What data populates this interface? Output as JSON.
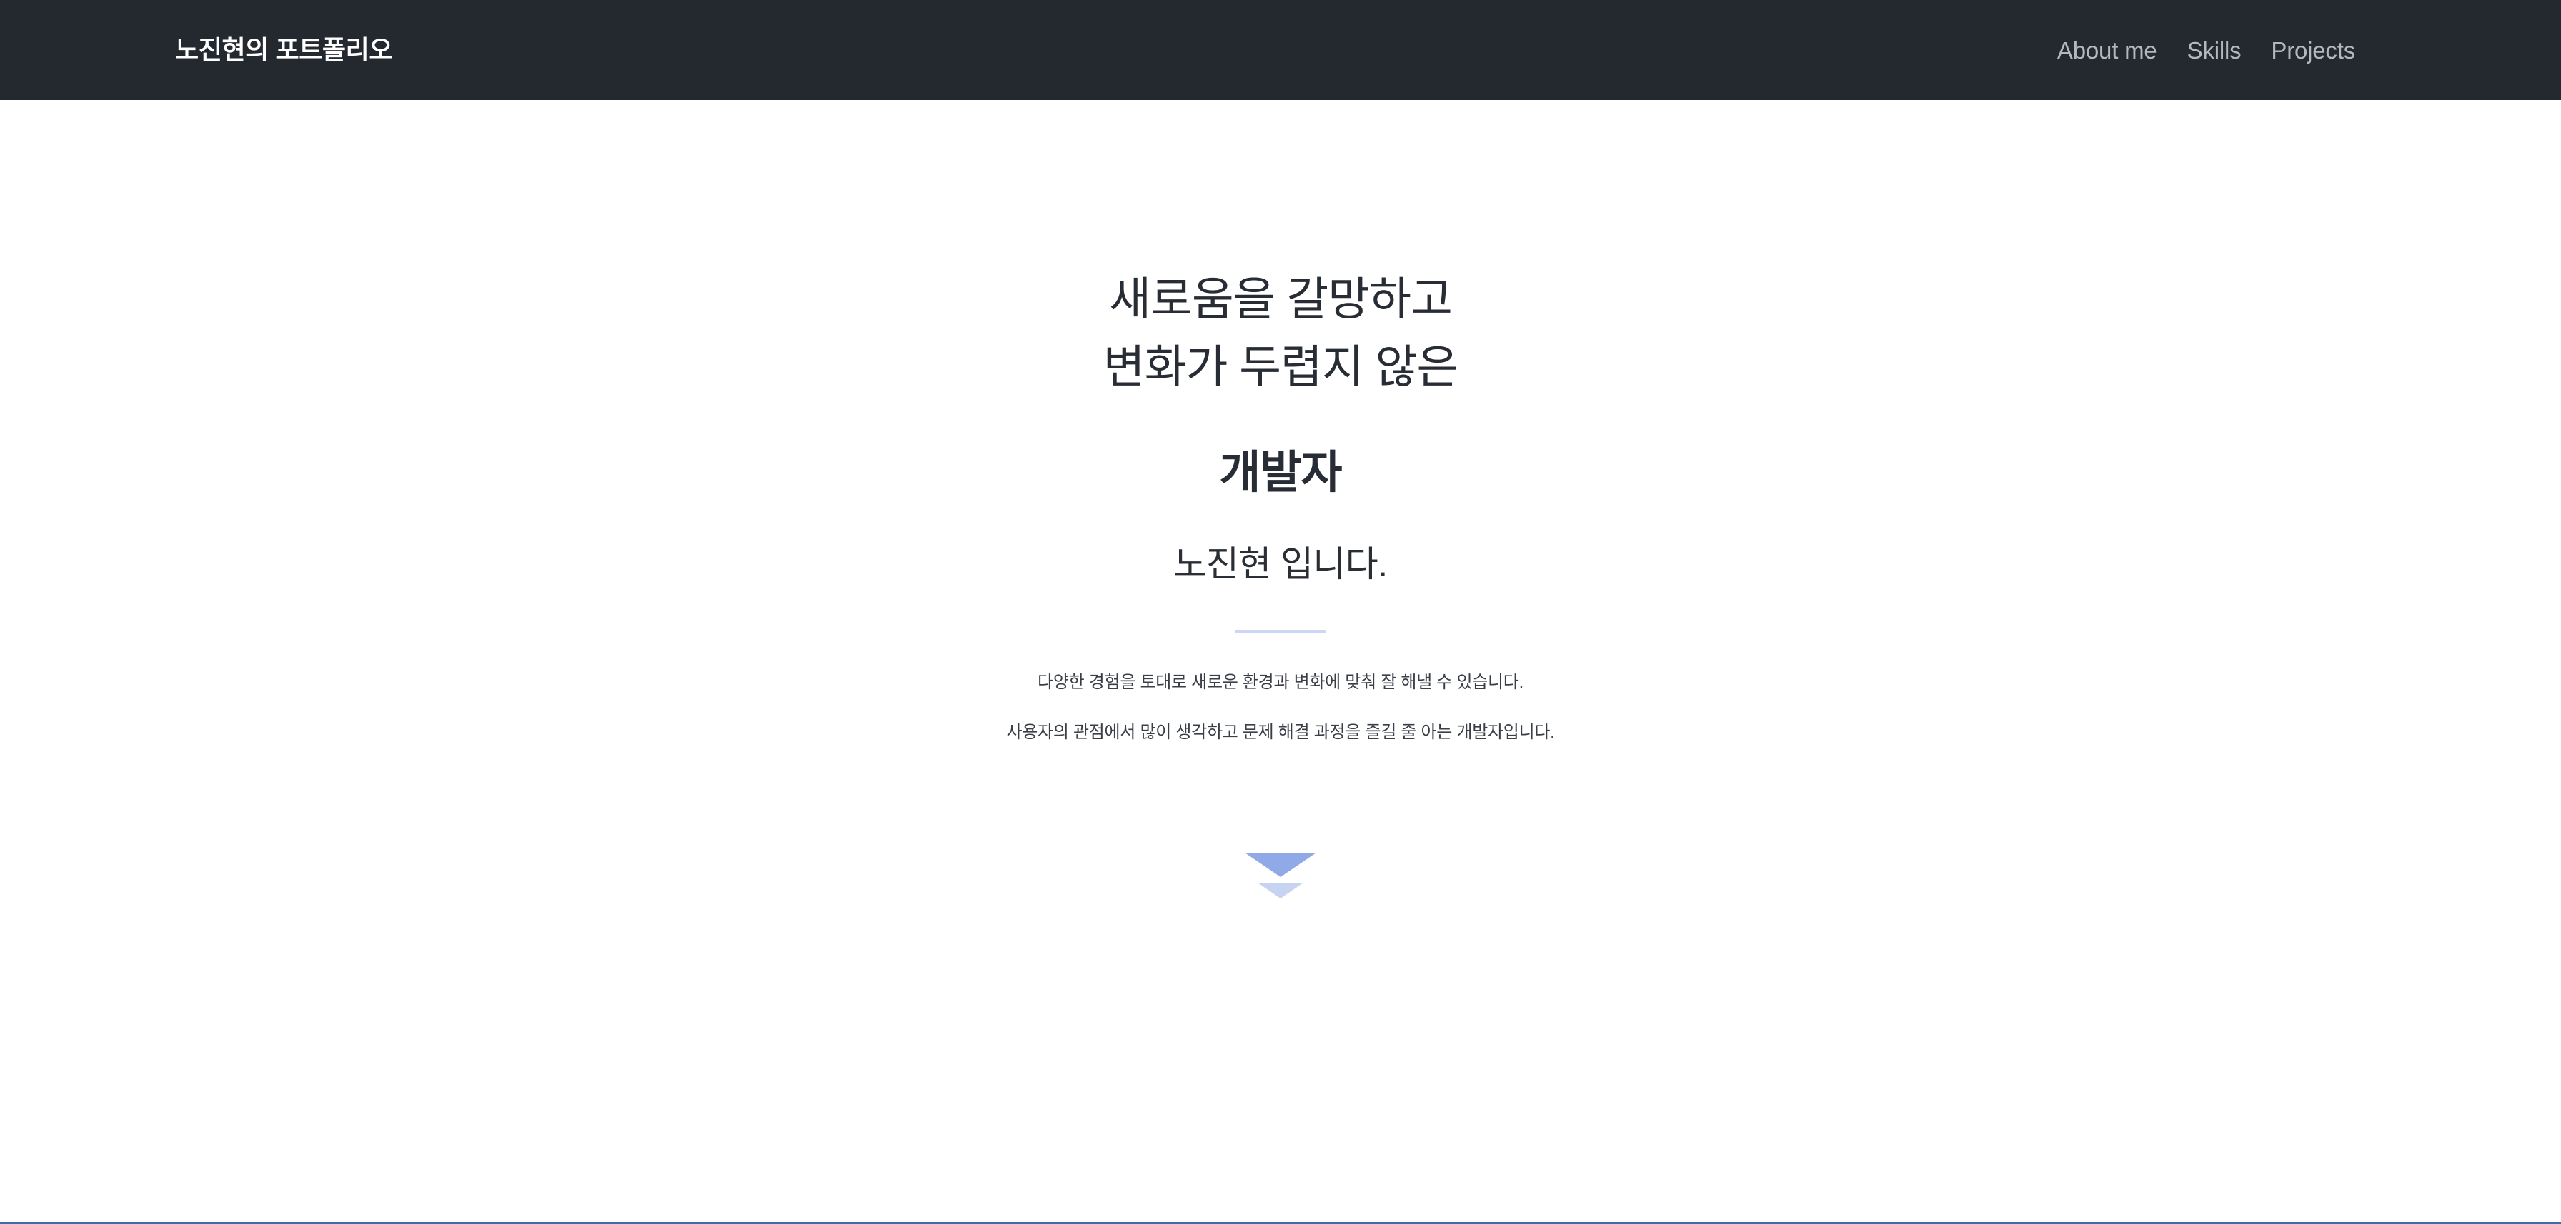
{
  "navbar": {
    "brand": "노진현의 포트폴리오",
    "links": [
      {
        "label": "About me"
      },
      {
        "label": "Skills"
      },
      {
        "label": "Projects"
      }
    ]
  },
  "hero": {
    "heading_line1": "새로움을 갈망하고",
    "heading_line2": "변화가 두렵지 않은",
    "role": "개발자",
    "name": "노진현 입니다.",
    "body_line1": "다양한 경험을 토대로 새로운 환경과 변화에 맞춰 잘 해낼 수 있습니다.",
    "body_line2": "사용자의 관점에서 많이 생각하고 문제 해결 과정을 즐길 줄 아는 개발자입니다.",
    "scroll_icon": "chevron-down-double-icon"
  },
  "colors": {
    "navbar_background": "#24282f",
    "brand_text": "#ffffff",
    "nav_link_text": "#b4b8bd",
    "heading_text": "#282c34",
    "body_text": "#3a3f47",
    "divider": "#ccd6f5",
    "chevron_primary": "#90aae7",
    "chevron_secondary": "#c6d3f1",
    "section_edge": "#3b6cb0",
    "page_background": "#ffffff"
  }
}
